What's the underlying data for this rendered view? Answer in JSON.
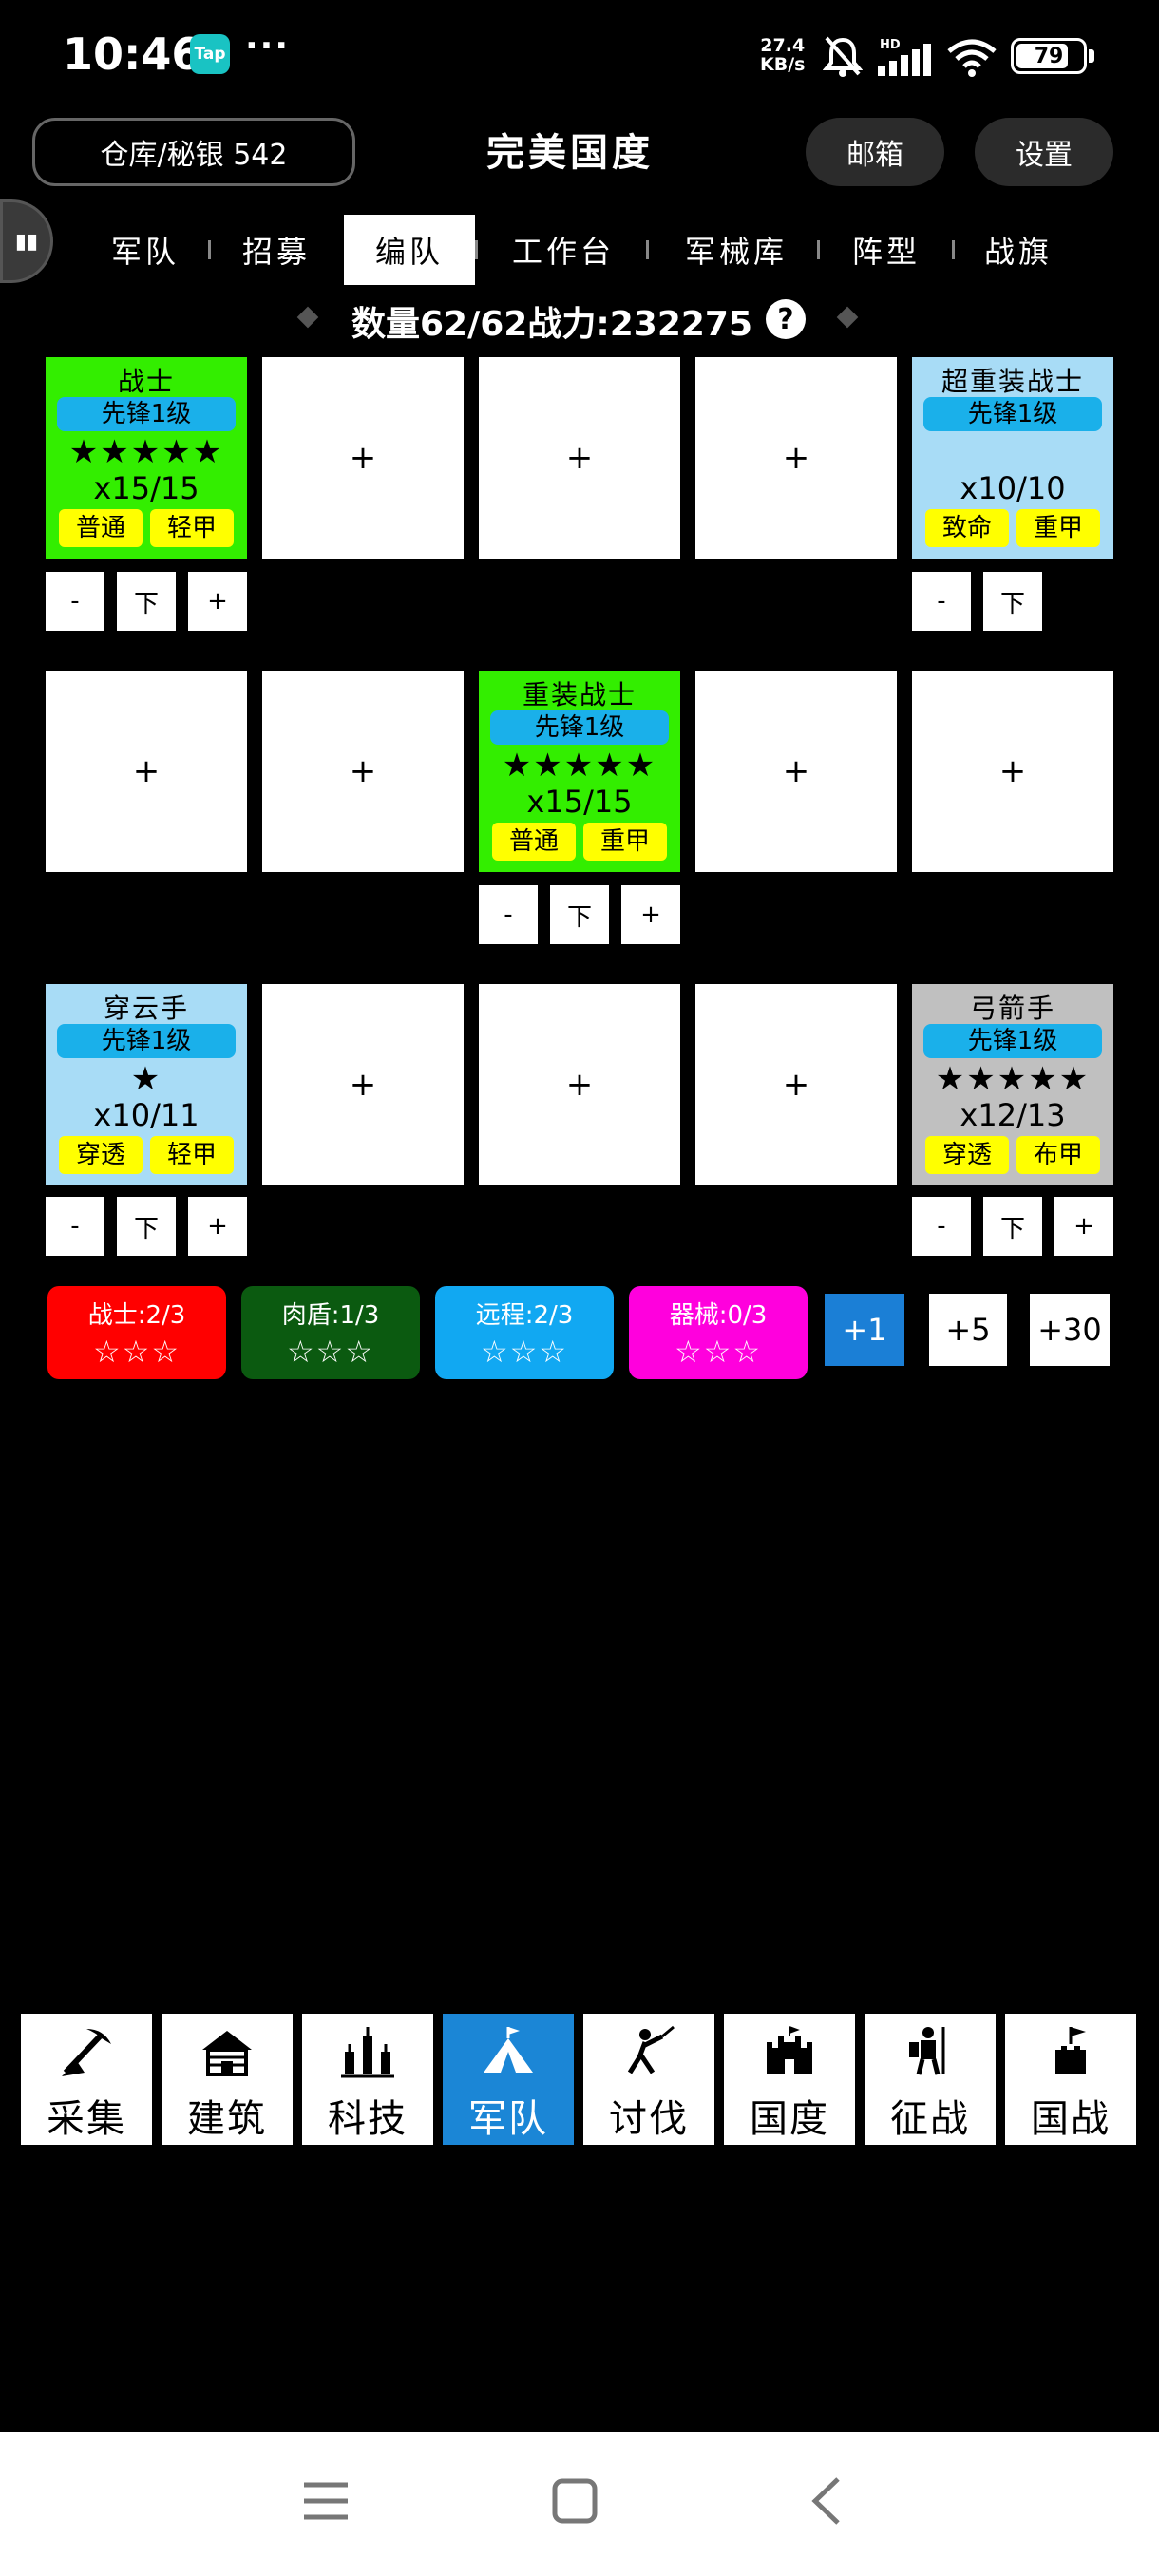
{
  "status_bar": {
    "time": "10:46",
    "tap_badge": "Tap",
    "more_dots": "···",
    "net_speed_value": "27.4",
    "net_speed_unit": "KB/s",
    "battery": "79",
    "battery_level": 0.79
  },
  "header": {
    "warehouse": "仓库/秘银 542",
    "title": "完美国度",
    "mailbox": "邮箱",
    "settings": "设置"
  },
  "tabs": [
    {
      "label": "军队"
    },
    {
      "label": "招募"
    },
    {
      "label": "编队",
      "active": true
    },
    {
      "label": "工作台"
    },
    {
      "label": "军械库"
    },
    {
      "label": "阵型"
    },
    {
      "label": "战旗"
    }
  ],
  "summary": "数量62/62战力:232275",
  "grid": {
    "empty_slot": "+",
    "controls": {
      "minus": "-",
      "down": "下",
      "plus": "+"
    },
    "units": [
      {
        "name": "战士",
        "level": "先锋1级",
        "stars": "★★★★★",
        "count": "x15/15",
        "tag1": "普通",
        "tag2": "轻甲",
        "bg": "#33ee00"
      },
      {
        "name": "超重装战士",
        "level": "先锋1级",
        "stars": "",
        "count": "x10/10",
        "tag1": "致命",
        "tag2": "重甲",
        "bg": "#a8dcf6"
      },
      {
        "name": "重装战士",
        "level": "先锋1级",
        "stars": "★★★★★",
        "count": "x15/15",
        "tag1": "普通",
        "tag2": "重甲",
        "bg": "#33ee00"
      },
      {
        "name": "穿云手",
        "level": "先锋1级",
        "stars": "★",
        "count": "x10/11",
        "tag1": "穿透",
        "tag2": "轻甲",
        "bg": "#a8dcf6"
      },
      {
        "name": "弓箭手",
        "level": "先锋1级",
        "stars": "★★★★★",
        "count": "x12/13",
        "tag1": "穿透",
        "tag2": "布甲",
        "bg": "#c0c0c0"
      }
    ]
  },
  "class_stats": [
    {
      "label": "战士:2/3",
      "stars": "☆☆☆",
      "color": "#ff0000"
    },
    {
      "label": "肉盾:1/3",
      "stars": "☆☆☆",
      "color": "#0b5a10"
    },
    {
      "label": "远程:2/3",
      "stars": "☆☆☆",
      "color": "#11a8f2"
    },
    {
      "label": "器械:0/3",
      "stars": "☆☆☆",
      "color": "#ff00dd"
    }
  ],
  "increments": [
    "+1",
    "+5",
    "+30"
  ],
  "bottom_nav": [
    {
      "label": "采集",
      "icon": "pickaxe-icon"
    },
    {
      "label": "建筑",
      "icon": "house-icon"
    },
    {
      "label": "科技",
      "icon": "tech-icon"
    },
    {
      "label": "军队",
      "icon": "tent-icon",
      "active": true
    },
    {
      "label": "讨伐",
      "icon": "warrior-icon"
    },
    {
      "label": "国度",
      "icon": "castle-icon"
    },
    {
      "label": "征战",
      "icon": "knight-icon"
    },
    {
      "label": "国战",
      "icon": "flag-tower-icon"
    }
  ]
}
